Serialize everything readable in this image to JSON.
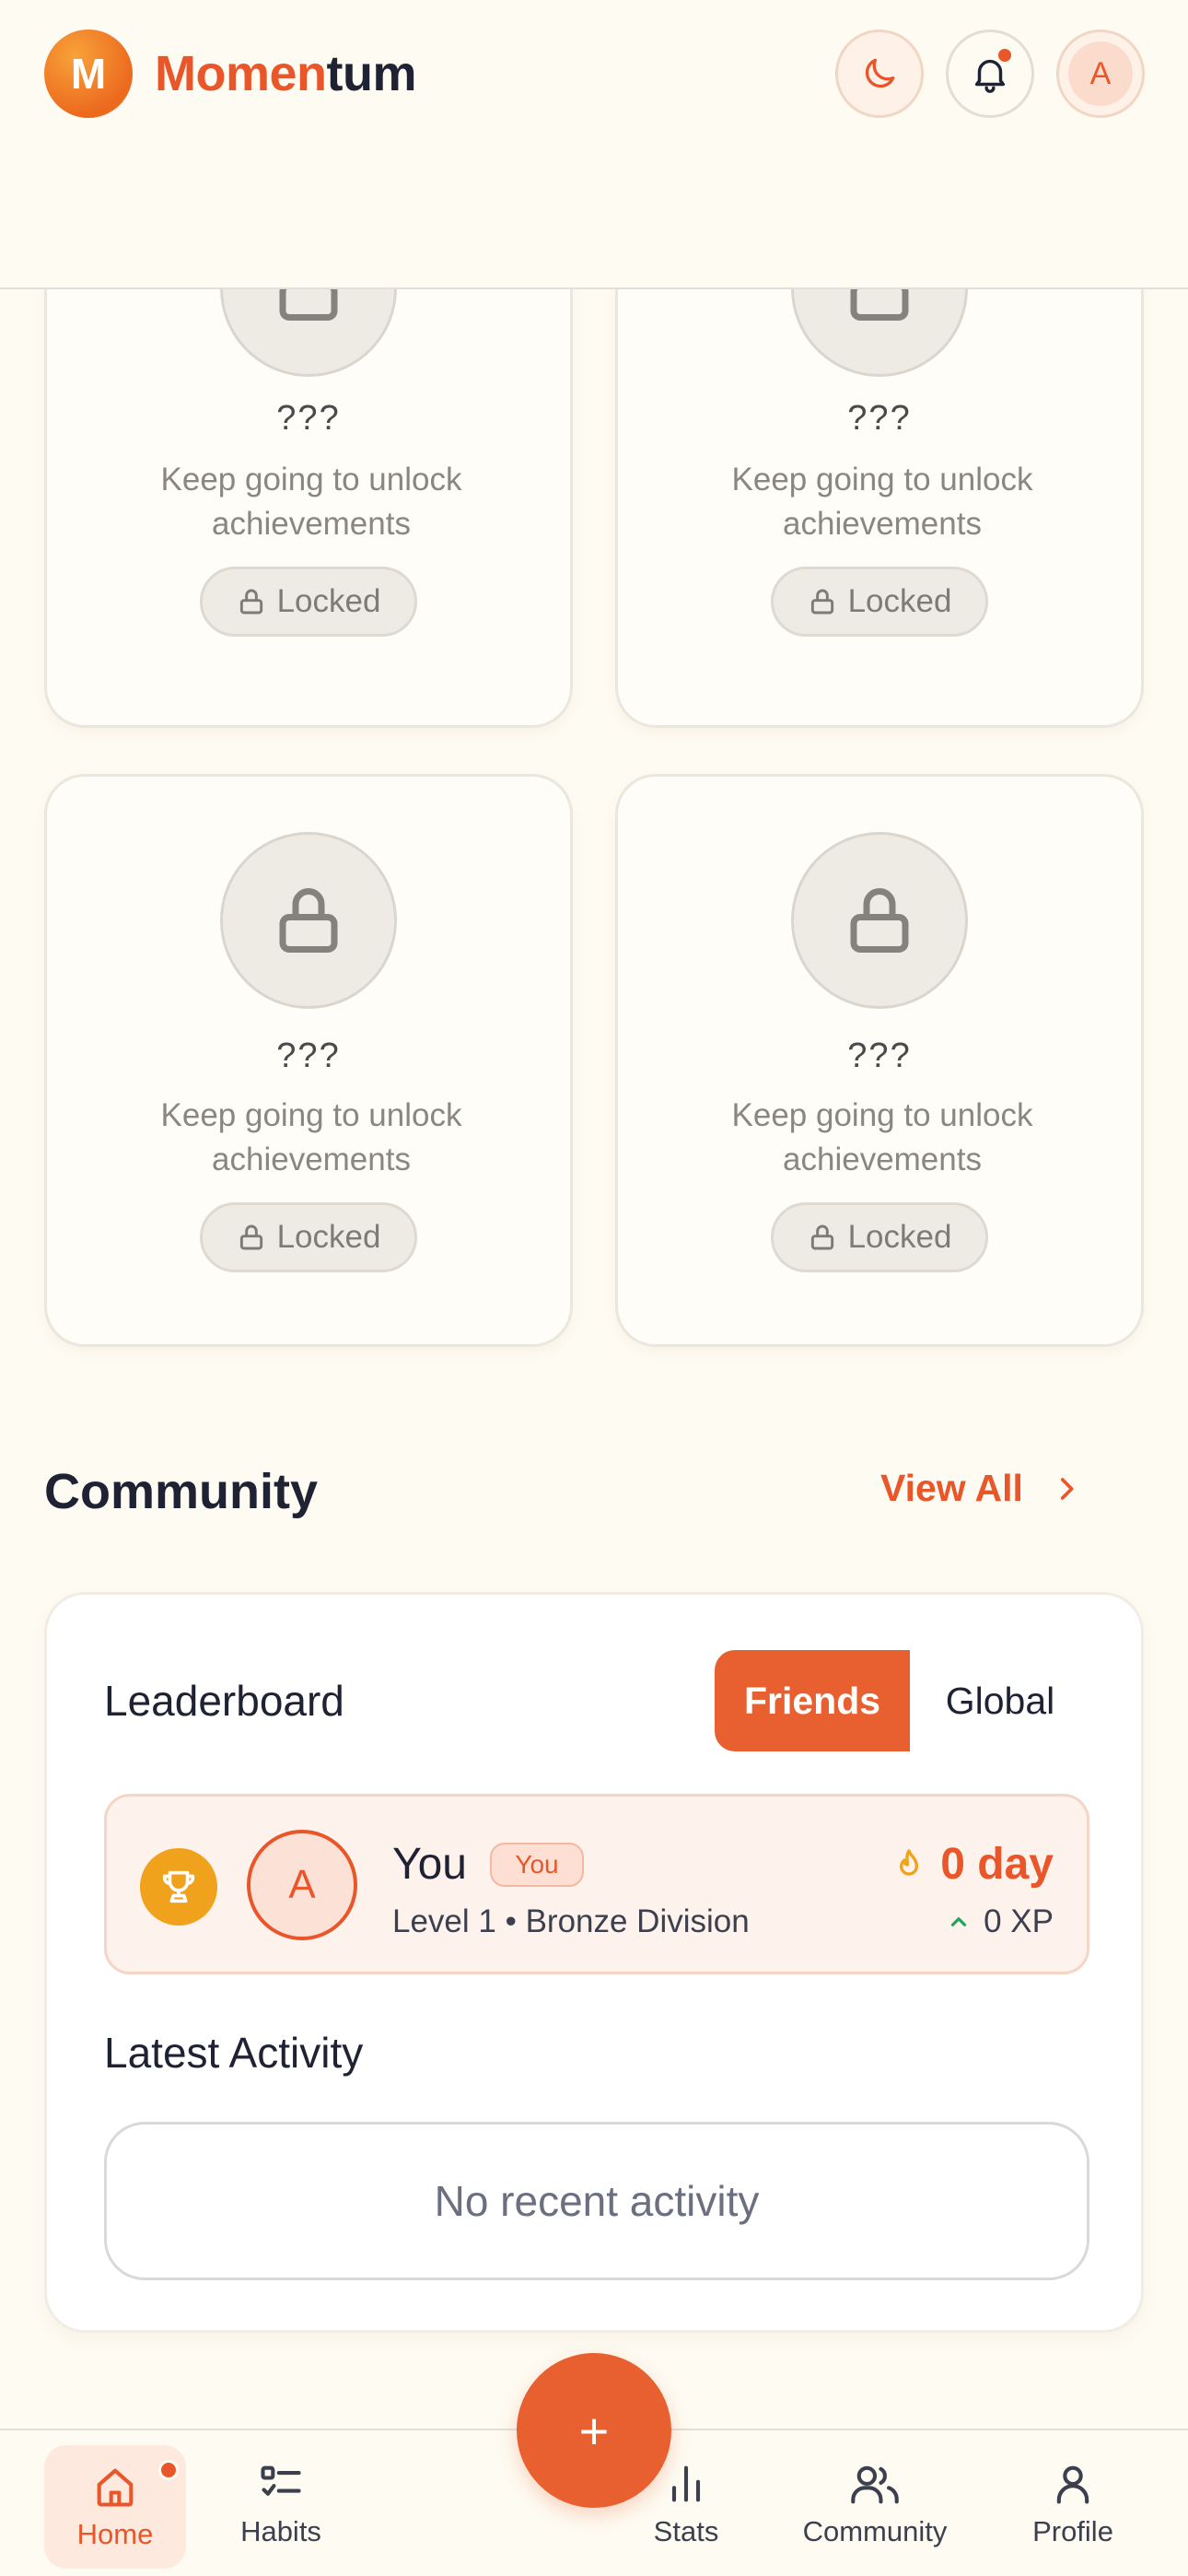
{
  "app": {
    "brand_part1": "Momen",
    "brand_part2": "tum",
    "logo_letter": "M",
    "accent": "#E8562A"
  },
  "header": {
    "theme_icon": "moon-icon",
    "notification_icon": "bell-icon",
    "avatar_letter": "A"
  },
  "achievements": [
    {
      "title": "???",
      "description": "Keep going to unlock achievements",
      "status": "Locked"
    },
    {
      "title": "???",
      "description": "Keep going to unlock achievements",
      "status": "Locked"
    },
    {
      "title": "???",
      "description": "Keep going to unlock achievements",
      "status": "Locked"
    },
    {
      "title": "???",
      "description": "Keep going to unlock achievements",
      "status": "Locked"
    }
  ],
  "community": {
    "title": "Community",
    "view_all": "View All",
    "leaderboard": {
      "title": "Leaderboard",
      "tabs": [
        "Friends",
        "Global"
      ],
      "active_tab": "Friends",
      "entry": {
        "avatar_letter": "A",
        "name": "You",
        "tag": "You",
        "meta": "Level 1 • Bronze Division",
        "streak": "0 day",
        "xp": "0 XP"
      }
    },
    "activity": {
      "title": "Latest Activity",
      "empty": "No recent activity"
    }
  },
  "fab": {
    "label": "+"
  },
  "nav": {
    "items": [
      {
        "label": "Home",
        "icon": "home-icon",
        "active": true
      },
      {
        "label": "Habits",
        "icon": "list-check-icon"
      },
      {
        "label": "Stats",
        "icon": "bar-chart-icon"
      },
      {
        "label": "Community",
        "icon": "users-icon"
      },
      {
        "label": "Profile",
        "icon": "user-icon"
      }
    ]
  }
}
